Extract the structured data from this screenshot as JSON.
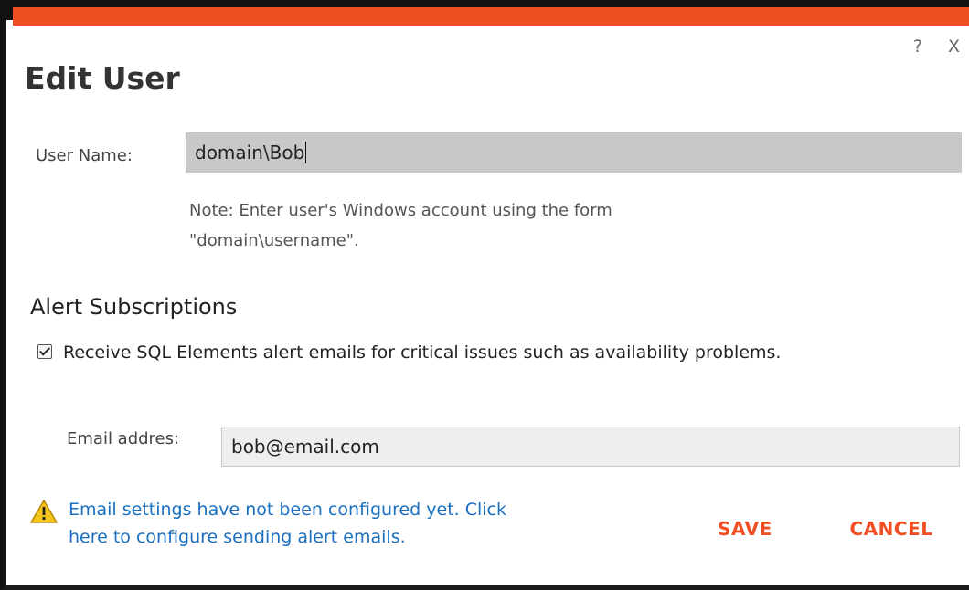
{
  "dialog": {
    "title": "Edit User",
    "help_label": "?",
    "close_label": "X",
    "accent_color": "#f04e23"
  },
  "user": {
    "label": "User Name:",
    "value": "domain\\Bob",
    "note_line1": "Note: Enter user's Windows account using the form",
    "note_line2": "\"domain\\username\"."
  },
  "alerts": {
    "section_title": "Alert Subscriptions",
    "checkbox_checked": true,
    "checkbox_label": "Receive SQL Elements alert emails for critical issues such as availability problems.",
    "email_label": "Email addres:",
    "email_value": "bob@email.com"
  },
  "warning": {
    "icon": "warning-icon",
    "line1": "Email settings have not been configured yet. Click",
    "line2": "here to configure sending alert emails.",
    "link_color": "#1a6fc0"
  },
  "buttons": {
    "save_label": "SAVE",
    "cancel_label": "CANCEL"
  }
}
